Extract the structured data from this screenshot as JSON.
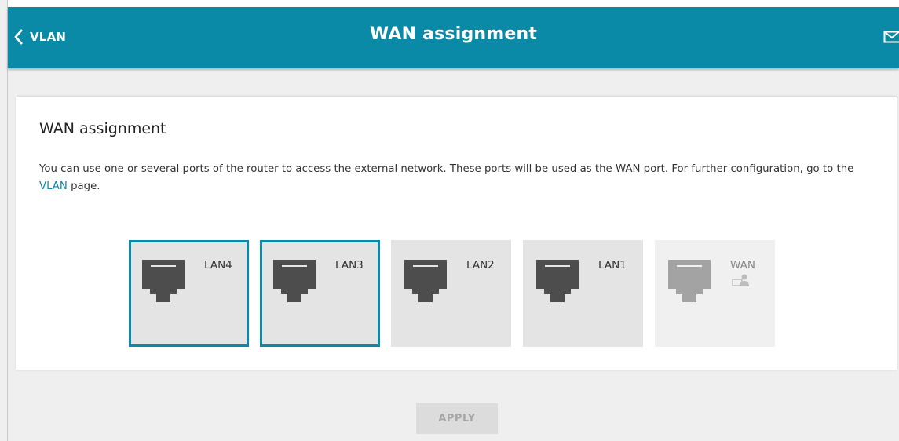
{
  "header": {
    "back_label": "VLAN",
    "title": "WAN assignment"
  },
  "card": {
    "title": "WAN assignment",
    "desc_pre": "You can use one or several ports of the router to access the external network. These ports will be used as the WAN port. For further configuration, go to the ",
    "desc_link": "VLAN",
    "desc_post": " page."
  },
  "ports": [
    {
      "label": "LAN4",
      "selected": true
    },
    {
      "label": "LAN3",
      "selected": true
    },
    {
      "label": "LAN2",
      "selected": false
    },
    {
      "label": "LAN1",
      "selected": false
    },
    {
      "label": "WAN",
      "selected": false,
      "disabled": true
    }
  ],
  "apply_label": "APPLY",
  "colors": {
    "accent": "#0b8aa8",
    "port_bg": "#e4e4e4",
    "jack": "#4d4d4d",
    "jack_disabled": "#a3a3a3"
  }
}
